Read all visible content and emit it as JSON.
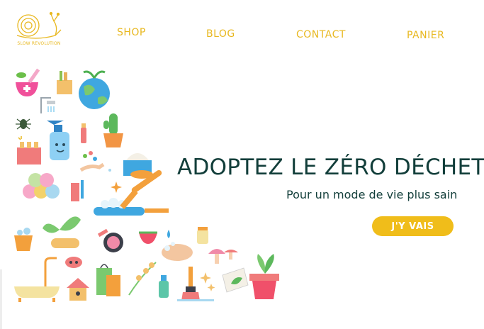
{
  "brand": {
    "logo_text": "SLOW REVOLUTION",
    "logo_icon": "snail-icon"
  },
  "nav": {
    "shop": "SHOP",
    "blog": "BLOG",
    "contact": "CONTACT",
    "cart": "PANIER"
  },
  "hero": {
    "title": "ADOPTEZ LE ZÉRO DÉCHET",
    "subtitle": "Pour un mode de vie plus sain",
    "cta": "J'Y VAIS"
  },
  "illustration_icons": [
    "mortar-pestle-icon",
    "grocery-bag-icon",
    "earth-globe-icon",
    "shower-icon",
    "insect-icon",
    "spray-bottle-icon",
    "small-bottle-icon",
    "cactus-pot-icon",
    "nail-polish-icon",
    "hand-pills-icon",
    "cream-jar-icon",
    "towel-rolls-icon",
    "toothpaste-icon",
    "frying-pan-icon",
    "sponge-icon",
    "bucket-icon",
    "sprout-icon",
    "compact-mirror-icon",
    "watermelon-icon",
    "water-drop-icon",
    "jar-icon",
    "hand-washing-icon",
    "mushroom-icon",
    "bathtub-icon",
    "ladybug-icon",
    "birdhouse-icon",
    "shopping-bag-icon",
    "branch-icon",
    "spray-icon",
    "paint-brush-icon",
    "sparkle-icon",
    "leaf-tag-icon",
    "potted-plant-icon"
  ],
  "colors": {
    "accent": "#f0bd1a",
    "heading": "#123e3a",
    "nav": "#e8b820"
  }
}
